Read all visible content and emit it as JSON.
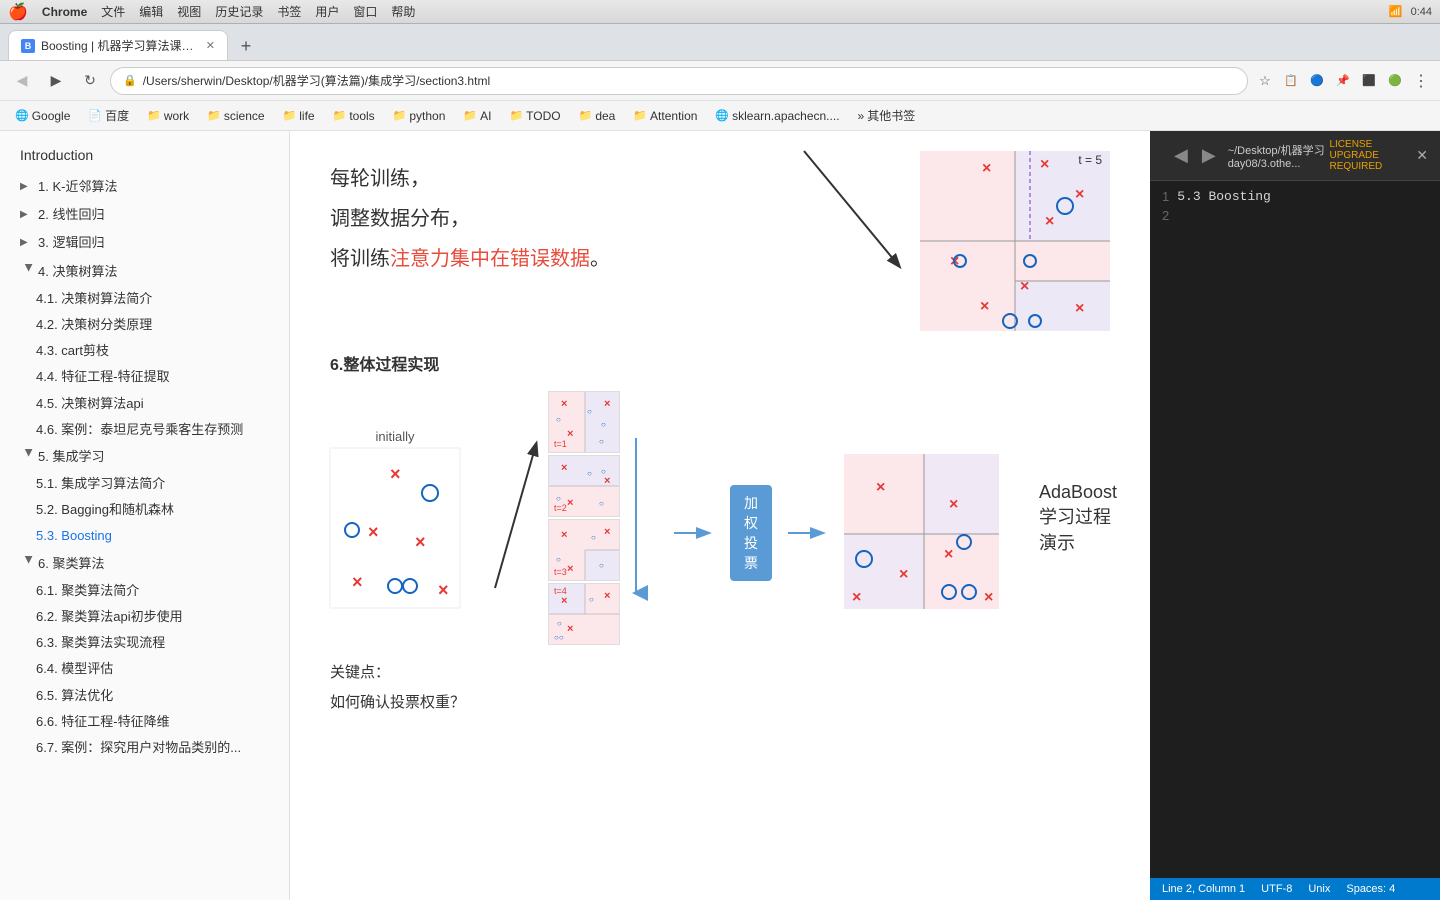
{
  "macos": {
    "app": "Chrome",
    "menu_items": [
      "Chrome",
      "文件",
      "编辑",
      "视图",
      "历史记录",
      "书签",
      "用户",
      "窗口",
      "帮助"
    ],
    "time": "0:44",
    "battery": "██"
  },
  "browser": {
    "tab_title": "Boosting | 机器学习算法课程z...",
    "url": "/Users/sherwin/Desktop/机器学习(算法篇)/集成学习/section3.html",
    "bookmarks": [
      "Google",
      "百度",
      "work",
      "science",
      "life",
      "tools",
      "python",
      "AI",
      "TODO",
      "dea",
      "Attention",
      "sklearn.apachecn....",
      "其他书签"
    ]
  },
  "sidebar": {
    "title": "Introduction",
    "items": [
      {
        "label": "1. K-近邻算法",
        "indent": 0,
        "collapsed": true
      },
      {
        "label": "2. 线性回归",
        "indent": 0,
        "collapsed": true
      },
      {
        "label": "3. 逻辑回归",
        "indent": 0,
        "collapsed": true
      },
      {
        "label": "4. 决策树算法",
        "indent": 0,
        "collapsed": false
      },
      {
        "label": "4.1. 决策树算法简介",
        "indent": 1
      },
      {
        "label": "4.2. 决策树分类原理",
        "indent": 1
      },
      {
        "label": "4.3. cart剪枝",
        "indent": 1
      },
      {
        "label": "4.4. 特征工程-特征提取",
        "indent": 1
      },
      {
        "label": "4.5. 决策树算法api",
        "indent": 1
      },
      {
        "label": "4.6. 案例：泰坦尼克号乘客生存预测",
        "indent": 1
      },
      {
        "label": "5. 集成学习",
        "indent": 0,
        "collapsed": false
      },
      {
        "label": "5.1. 集成学习算法简介",
        "indent": 1
      },
      {
        "label": "5.2. Bagging和随机森林",
        "indent": 1
      },
      {
        "label": "5.3. Boosting",
        "indent": 1,
        "active": true
      },
      {
        "label": "6. 聚类算法",
        "indent": 0,
        "collapsed": false
      },
      {
        "label": "6.1. 聚类算法简介",
        "indent": 1
      },
      {
        "label": "6.2. 聚类算法api初步使用",
        "indent": 1
      },
      {
        "label": "6.3. 聚类算法实现流程",
        "indent": 1
      },
      {
        "label": "6.4. 模型评估",
        "indent": 1
      },
      {
        "label": "6.5. 算法优化",
        "indent": 1
      },
      {
        "label": "6.6. 特征工程-特征降维",
        "indent": 1
      },
      {
        "label": "6.7. 案例：探究用户对物品类别的...",
        "indent": 1
      }
    ]
  },
  "content": {
    "diagram_text_line1": "每轮训练，",
    "diagram_text_line2": "调整数据分布，",
    "diagram_text_line3_prefix": "将训练",
    "diagram_text_line3_highlight": "注意力集中在错误数据",
    "diagram_text_line3_suffix": "。",
    "t5_label": "t = 5",
    "section6_title": "6.整体过程实现",
    "adaboost_title": "AdaBoost学习过程演示",
    "initially_label": "initially",
    "weighted_vote_btn": "加权投票",
    "key_points_title": "关键点：",
    "key_question": "如何确认投票权重？"
  },
  "right_panel": {
    "title": "~/Desktop/机器学习day08/3.othe...LICENSE UPGRADE REQUIRED",
    "line1": "5.3  Boosting",
    "line2": "",
    "line_nums": [
      "1",
      "2"
    ]
  },
  "status_bar": {
    "line_col": "Line 2, Column 1",
    "encoding": "UTF-8",
    "line_ending": "Unix",
    "spaces": "Spaces: 4"
  }
}
